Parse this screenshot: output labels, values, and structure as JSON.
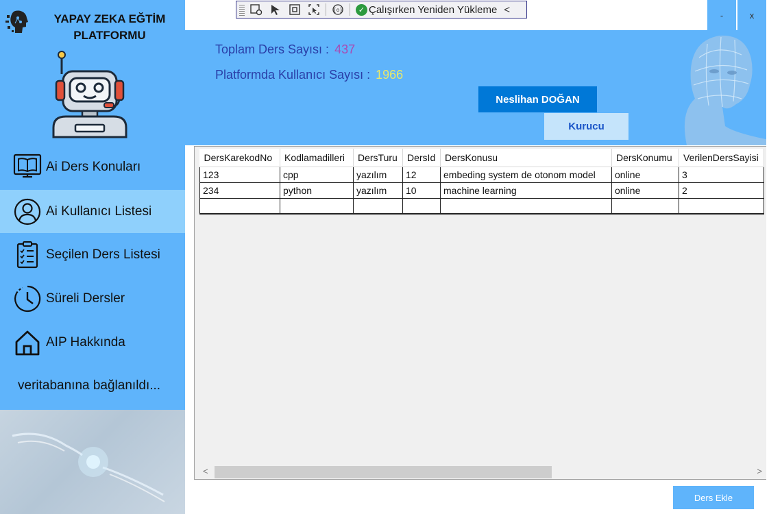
{
  "brand": {
    "title_line1": "YAPAY ZEKA EĞTİM",
    "title_line2": "PLATFORMU"
  },
  "nav": {
    "items": [
      {
        "label": "Ai Ders Konuları",
        "icon": "monitor-book-icon"
      },
      {
        "label": "Ai Kullanıcı Listesi",
        "icon": "user-circle-icon"
      },
      {
        "label": "Seçilen Ders Listesi",
        "icon": "clipboard-list-icon"
      },
      {
        "label": "Süreli Dersler",
        "icon": "clock-icon"
      },
      {
        "label": "AIP Hakkında",
        "icon": "home-icon"
      }
    ],
    "active_index": 1
  },
  "status": "veritabanına bağlanıldı...",
  "devtoolbar": {
    "hot_reload_label": "Çalışırken Yeniden Yükleme"
  },
  "window": {
    "minimize": "-",
    "close": "x"
  },
  "header": {
    "total_courses_label": "Toplam Ders Sayısı :",
    "total_courses_value": "437",
    "users_label": "Platformda Kullanıcı Sayısı :",
    "users_value": "1966",
    "user_name": "Neslihan DOĞAN",
    "user_role": "Kurucu"
  },
  "grid": {
    "columns": [
      "DersKarekodNo",
      "Kodlamadilleri",
      "DersTuru",
      "DersId",
      "DersKonusu",
      "DersKonumu",
      "VerilenDersSayisi"
    ],
    "rows": [
      [
        "123",
        "cpp",
        "yazılım",
        "12",
        "embeding system de otonom model",
        "online",
        "3"
      ],
      [
        "234",
        "python",
        "yazılım",
        "10",
        "machine learning",
        "online",
        "2"
      ]
    ]
  },
  "actions": {
    "add_course": "Ders Ekle"
  },
  "colors": {
    "panel_blue": "#5fb4fb",
    "active_nav": "#8fd0fc",
    "user_button": "#0078d7",
    "role_button": "#c5e4fb"
  }
}
